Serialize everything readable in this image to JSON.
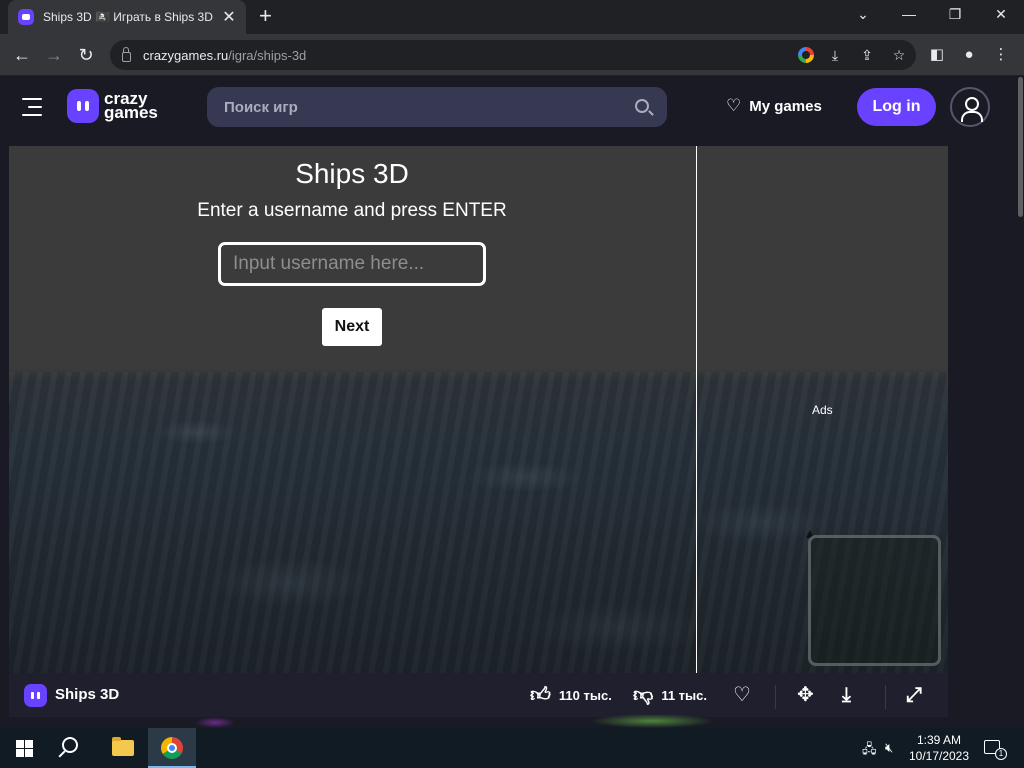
{
  "browser": {
    "tab_title": "Ships 3D 🏴‍☠️ Играть в Ships 3D",
    "tab_close": "✕",
    "new_tab": "+",
    "url_host": "crazygames.ru",
    "url_path": "/igra/ships-3d",
    "window_buttons": {
      "tabsearch": "⌄",
      "minimize": "—",
      "restore": "❐",
      "close": "✕"
    },
    "icons": [
      "back-arrow-icon",
      "forward-arrow-icon",
      "reload-icon",
      "lock-icon",
      "google-icon",
      "install-app-icon",
      "share-icon",
      "bookmark-star-icon",
      "side-panel-icon",
      "profile-icon",
      "kebab-menu-icon"
    ]
  },
  "site": {
    "logo_line1": "crazy",
    "logo_line2": "games",
    "search_placeholder": "Поиск игр",
    "my_games": "My games",
    "login": "Log in"
  },
  "game": {
    "title": "Ships 3D",
    "subtitle": "Enter a username and press ENTER",
    "username_placeholder": "Input username here...",
    "username_value": "",
    "next_label": "Next",
    "ads_label": "Ads"
  },
  "gamebar": {
    "name": "Ships 3D",
    "likes": "110 тыс.",
    "dislikes": "11 тыс."
  },
  "taskbar": {
    "time": "1:39 AM",
    "date": "10/17/2023",
    "notification_count": "1"
  },
  "colors": {
    "brand": "#6842ff",
    "header_bg": "#1a1a24",
    "search_bg": "#373952"
  }
}
